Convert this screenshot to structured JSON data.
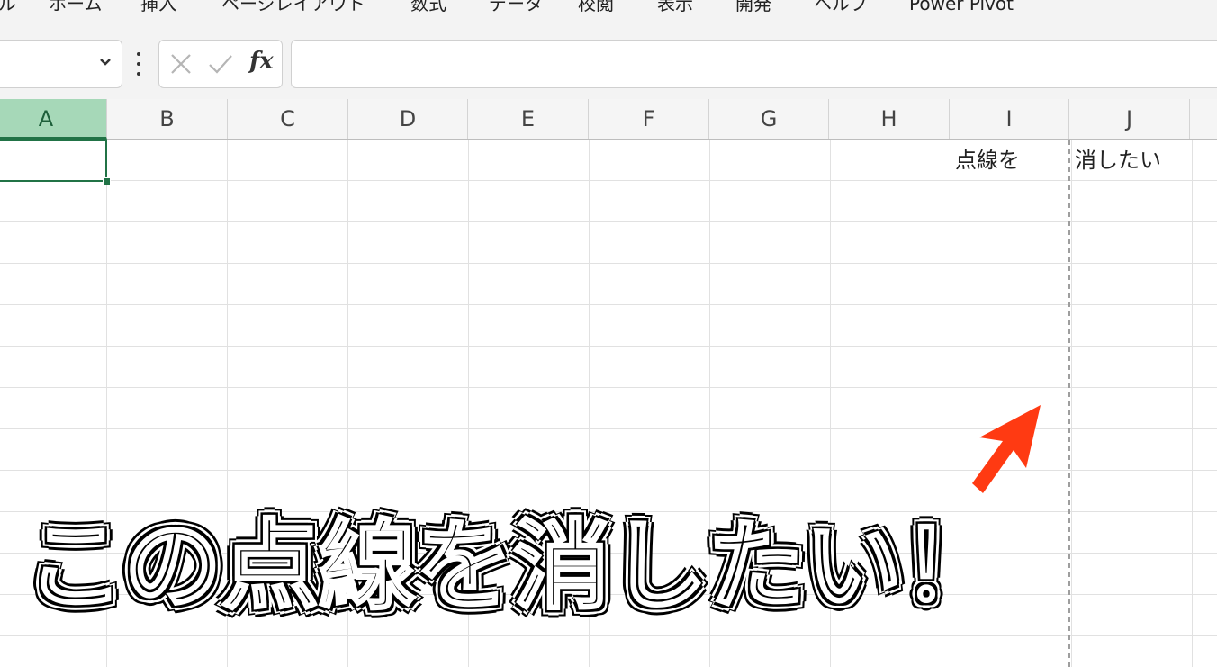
{
  "ribbon": {
    "tabs": [
      "ル",
      "ホーム",
      "挿入",
      "ページレイアウト",
      "数式",
      "データ",
      "校閲",
      "表示",
      "開発",
      "ヘルプ",
      "Power Pivot"
    ]
  },
  "formula_bar": {
    "name_box_value": "",
    "formula_value": "",
    "fx_label": "fx"
  },
  "sheet": {
    "columns": [
      "A",
      "B",
      "C",
      "D",
      "E",
      "F",
      "G",
      "H",
      "I",
      "J"
    ],
    "selected_column": "A",
    "cells": {
      "I1": "点線を",
      "J1": "消したい"
    }
  },
  "overlay": {
    "caption": "この点線を消したい！",
    "arrow_color": "#ff3a12"
  },
  "colors": {
    "accent": "#217346",
    "page_break_line": "#9e9e9e"
  }
}
